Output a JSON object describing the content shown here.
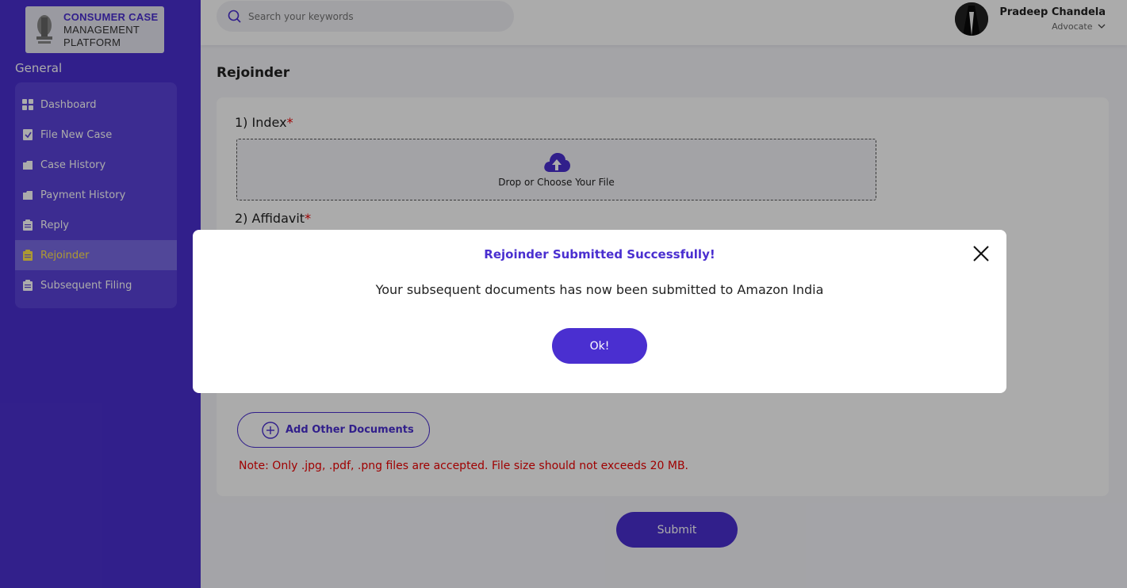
{
  "brand": {
    "line1": "CONSUMER CASE",
    "line2": "MANAGEMENT",
    "line3": "PLATFORM"
  },
  "sidebar": {
    "section_title": "General",
    "items": [
      {
        "label": "Dashboard",
        "icon": "dashboard-icon"
      },
      {
        "label": "File New Case",
        "icon": "file-icon"
      },
      {
        "label": "Case History",
        "icon": "folder-icon"
      },
      {
        "label": "Payment History",
        "icon": "folder-icon"
      },
      {
        "label": "Reply",
        "icon": "clipboard-icon"
      },
      {
        "label": "Rejoinder",
        "icon": "clipboard-icon",
        "active": true
      },
      {
        "label": "Subsequent Filing",
        "icon": "clipboard-icon"
      }
    ]
  },
  "topbar": {
    "search_placeholder": "Search your keywords",
    "user_name": "Pradeep Chandela",
    "user_role": "Advocate"
  },
  "main": {
    "page_title": "Rejoinder",
    "fields": [
      {
        "label": "1) Index",
        "required": "*"
      },
      {
        "label": "2) Affidavit",
        "required": "*"
      }
    ],
    "dropzone_text": "Drop or Choose Your File",
    "add_other_label": "Add Other Documents",
    "note": "Note: Only .jpg, .pdf, .png files are accepted. File size should not exceeds 20 MB.",
    "submit_label": "Submit"
  },
  "modal": {
    "title": "Rejoinder Submitted Successfully!",
    "message": "Your subsequent documents has now been submitted to Amazon India",
    "ok_label": "Ok!"
  },
  "colors": {
    "primary": "#4a2fd0",
    "active_text": "#ffe44d",
    "error": "#e00000"
  }
}
